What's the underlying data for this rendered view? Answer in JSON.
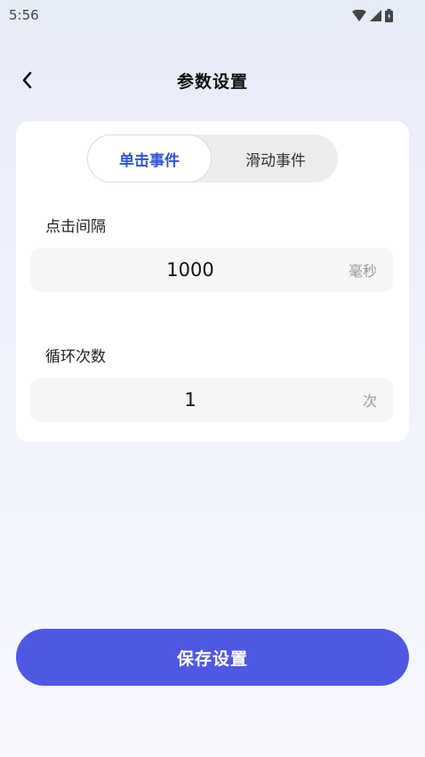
{
  "status_bar": {
    "time": "5:56",
    "icons": [
      "wifi-icon",
      "cell-signal-icon",
      "battery-icon"
    ]
  },
  "header": {
    "title": "参数设置",
    "back_icon": "chevron-left-icon"
  },
  "tabs": [
    {
      "label": "单击事件",
      "selected": true
    },
    {
      "label": "滑动事件",
      "selected": false
    }
  ],
  "fields": {
    "click_interval": {
      "label": "点击间隔",
      "value": "1000",
      "unit": "毫秒"
    },
    "loop_count": {
      "label": "循环次数",
      "value": "1",
      "unit": "次"
    }
  },
  "save_button": {
    "label": "保存设置"
  },
  "colors": {
    "accent": "#4f58e3",
    "tab_active_text": "#2f55d4",
    "background_top": "#e6ebf8"
  }
}
